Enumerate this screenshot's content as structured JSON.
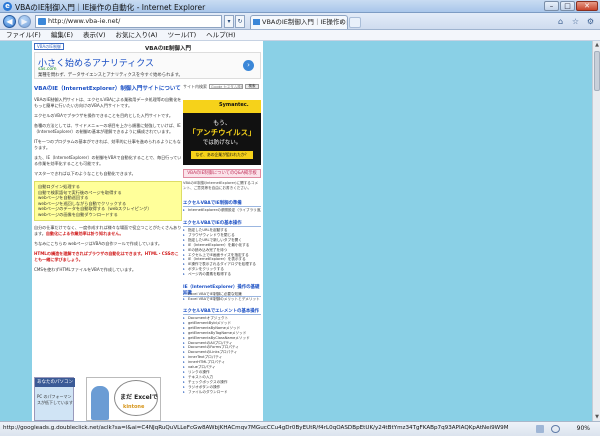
{
  "window": {
    "title": "VBAのIE制御入門｜IE操作の自動化 - Internet Explorer",
    "minimize": "–",
    "maximize": "□",
    "close": "✕"
  },
  "nav": {
    "url": "http://www.vba-ie.net/",
    "back_icon": "◀",
    "forward_icon": "▶",
    "tab_title": "VBAのIE制御入門｜IE操作の自..."
  },
  "menu": [
    "ファイル(F)",
    "編集(E)",
    "表示(V)",
    "お気に入り(A)",
    "ツール(T)",
    "ヘルプ(H)"
  ],
  "page": {
    "logo_text": "VBAのIE制御",
    "site_title": "VBAのIE制御入門",
    "ad_top": {
      "headline": "小さく始めるアナリティクス",
      "url": "sas.com",
      "body": "業種を問わず、データサイエンスとアナリティクスを今すぐ始められます。"
    },
    "main_title": "VBAのIE（InternetExplorer）制御入門サイトについて",
    "paragraphs": [
      "VBAのIE制御入門サイトは、エクセルVBAによる業務用データ処理等の自動化をもっと簡単に行いたい方向けのVBA入門サイトです。",
      "エクセルのVBAでブラウザを操作できることを目的とした入門サイトです。",
      "各種の方法としては、サイドメニューの項目を上から順番に勉強していけば、IE（InternetExplorer）の制御の基本が理解できるように構成されています。",
      "ITを一つのプログラムの基本ができれば、効率的に仕事を進められるようにもなります。",
      "また、IE（InternetExplorer）の制御をVBAで自動化することで、毎日行っている作業を効率化することも可能です。",
      "マスターできれば以下のようなことも自動化できます。"
    ],
    "topics": [
      "自動ログイン処理する",
      "自動で検索語句で実行後のページを取得する",
      "webページを自動巡回する",
      "webページを巡回しながら自動でクリックする",
      "webページのデータを自動取得する（webスクレイピング）",
      "webページの画像を自動ダウンロードする"
    ],
    "para_after": "自分の仕事だけでなく、一度作成すれば様々な場面で役立つことがたくさんあります。",
    "red_note": "自動化による作業効率は計り知れません。",
    "para2": "ちなみにこちらの webページはVBAの自作ツールで作成しています。",
    "html_note": "HTMLの構造を理解できればブラウザの自動化はできます。HTML・CSSのことも一緒に学びましょう。",
    "para3": "CMSを使わずHTMLファイルをVBAで作成しています。"
  },
  "sidebar": {
    "search_label": "サイト内検索",
    "search_placeholder": "Google カスタム検索",
    "search_button": "検索",
    "symantec": {
      "brand": "Symantec.",
      "l1": "もう、",
      "l2": "「アンチウイルス」",
      "l3": "では防げない。",
      "cta": "なぜ、あの企業が狙われたか？"
    },
    "pink": "VBAのIE制御についてのQ&A掲示板",
    "desc": "VBAのIE制御(InternetExplorer)に関するコメント、ご意見等を自由にお書きください。",
    "sec1": "エクセルVBAでIE制御の準備",
    "list1": [
      "InternetExplorerの参照設定（ライブラリ追加）"
    ],
    "sec2": "エクセルVBAでIEの基本操作",
    "list2": [
      "指定したURLを起動する",
      "ブラウザウィンドウを閉じる",
      "指定したURLで新しいタブを開く",
      "IE（InternetExplorer）を最小化する",
      "IEの読み込み完了を待つ",
      "エクセル上でIE画面サイズを指定する",
      "IE（InternetExplorer）を表示する",
      "IE操作で表示されるダイアログを処理する",
      "ボタンをクリックする",
      "ページ内の要素を取得する"
    ],
    "sec3": "IE（InternetExplorer）操作の基礎知識",
    "list3": [
      "Excel VBAでIE制御に必要な知識",
      "Excel VBAでIE制御のメリットとデメリット"
    ],
    "sec4": "エクセルVBAでエレメントの基本操作",
    "list4": [
      "Documentオブジェクト",
      "getElementByIdメソッド",
      "getElementsByNameメソッド",
      "getElementsByTagNameメソッド",
      "getElementsByClassNameメソッド",
      "DocumentのAllプロパティ",
      "DocumentのFormsプロパティ",
      "DocumentのLinksプロパティ",
      "innerTextプロパティ",
      "innerHTMLプロパティ",
      "valueプロパティ",
      "リンクの操作",
      "テキストの入力",
      "チェックボックスの操作",
      "ラジオボタンの操作",
      "ファイルのダウンロード"
    ]
  },
  "bottom_ads": {
    "security_caption": "あなたのパソコン",
    "security_msg": "PC のパフォーマンスが低下しています",
    "excel_text": "まだ Excelで",
    "kintone": "kintone"
  },
  "status": {
    "url": "http://googleads.g.doubleclick.net/aclk?sa=l&ai=C4NJqRuQuVLLeFcGw8AWbjKHACmqv7MGucCCu4gDr0ByEUtR/f4rL0qOASDBpEtUK/y24tBtYmz34TgFKABp7q93APIAQKpAtNei9W9M8m-gAMBYAPBBXoEck_Odgh",
    "zoom": "90%"
  }
}
